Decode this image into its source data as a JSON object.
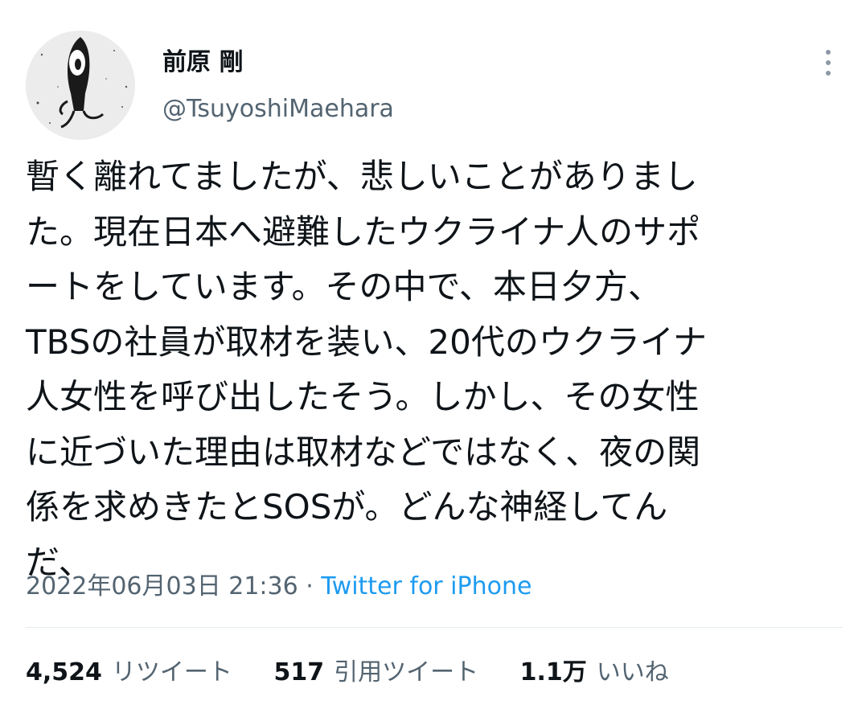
{
  "user": {
    "display_name": "前原 剛",
    "handle": "@TsuyoshiMaehara"
  },
  "tweet": {
    "lines": [
      "暫く離れてましたが、悲しいことがありまし",
      "た。現在日本へ避難したウクライナ人のサポ",
      "ートをしています。その中で、本日夕方、",
      "TBSの社員が取材を装い、20代のウクライナ",
      "人女性を呼び出したそう。しかし、その女性",
      "に近づいた理由は取材などではなく、夜の関",
      "係を求めきたとSOSが。どんな神経してん",
      "だ、"
    ],
    "timestamp": "2022年06月03日 21:36",
    "separator": " · ",
    "source": "Twitter for iPhone"
  },
  "stats": {
    "retweets": {
      "count": "4,524",
      "label": "リツイート"
    },
    "quotes": {
      "count": "517",
      "label": "引用ツイート"
    },
    "likes": {
      "count": "1.1万",
      "label": "いいね"
    }
  },
  "icons": {
    "more": "more-vertical-icon",
    "avatar": "avatar-image"
  },
  "colors": {
    "text_primary": "#0f1419",
    "text_secondary": "#536471",
    "link": "#1d9bf0",
    "divider": "#e6ecf0"
  }
}
